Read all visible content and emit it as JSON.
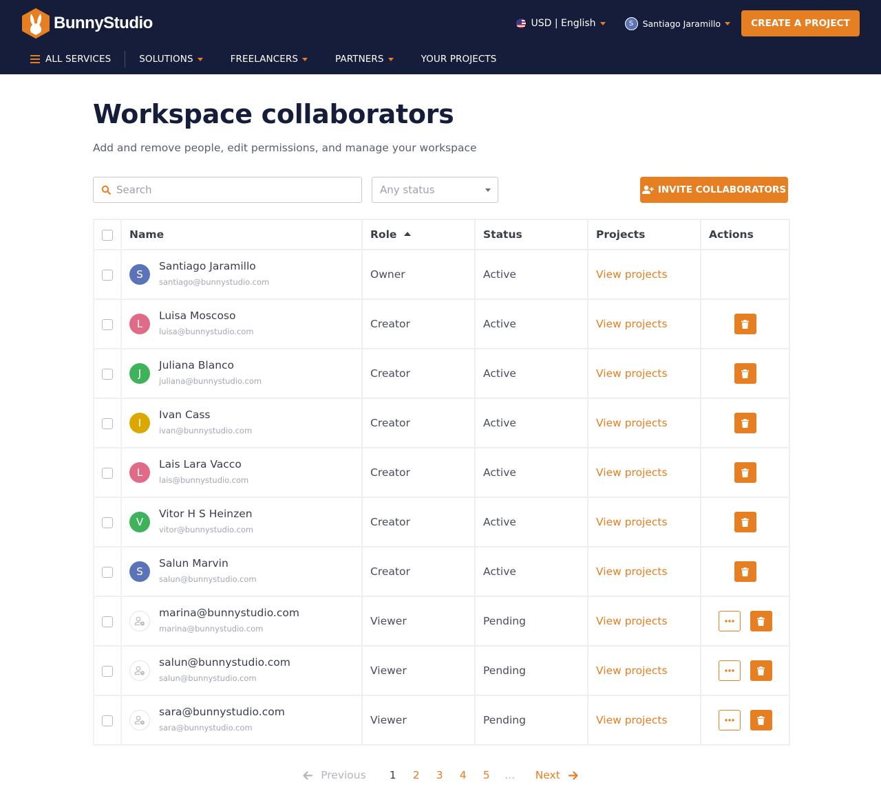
{
  "brand": {
    "name": "BunnyStudio",
    "accent": "#e67e22",
    "navy": "#161d3a"
  },
  "header": {
    "locale_label": "USD | English",
    "user_initial": "S",
    "user_name": "Santiago Jaramillo",
    "create_button": "CREATE A PROJECT"
  },
  "nav": {
    "all_services": "ALL SERVICES",
    "items": [
      {
        "label": "SOLUTIONS",
        "dropdown": true
      },
      {
        "label": "FREELANCERS",
        "dropdown": true
      },
      {
        "label": "PARTNERS",
        "dropdown": true
      },
      {
        "label": "YOUR PROJECTS",
        "dropdown": false
      }
    ]
  },
  "page": {
    "title": "Workspace collaborators",
    "subtitle": "Add and remove people, edit permissions, and manage your workspace"
  },
  "controls": {
    "search_placeholder": "Search",
    "search_value": "",
    "status_selected": "Any status",
    "invite_button": "INVITE COLLABORATORS"
  },
  "table": {
    "columns": {
      "name": "Name",
      "role": "Role",
      "status": "Status",
      "projects": "Projects",
      "actions": "Actions"
    },
    "sort": {
      "column": "Role",
      "direction": "ascending"
    },
    "rows": [
      {
        "initial": "S",
        "avatar_color": "#5b73b8",
        "name": "Santiago Jaramillo",
        "email": "santiago@bunnystudio.com",
        "role": "Owner",
        "status": "Active",
        "projects_link": "View projects",
        "actions": []
      },
      {
        "initial": "L",
        "avatar_color": "#e06b86",
        "name": "Luisa Moscoso",
        "email": "luisa@bunnystudio.com",
        "role": "Creator",
        "status": "Active",
        "projects_link": "View projects",
        "actions": [
          "delete"
        ]
      },
      {
        "initial": "J",
        "avatar_color": "#3fb35c",
        "name": "Juliana Blanco",
        "email": "juliana@bunnystudio.com",
        "role": "Creator",
        "status": "Active",
        "projects_link": "View projects",
        "actions": [
          "delete"
        ]
      },
      {
        "initial": "I",
        "avatar_color": "#dba800",
        "name": "Ivan Cass",
        "email": "ivan@bunnystudio.com",
        "role": "Creator",
        "status": "Active",
        "projects_link": "View projects",
        "actions": [
          "delete"
        ]
      },
      {
        "initial": "L",
        "avatar_color": "#e06b86",
        "name": "Lais Lara Vacco",
        "email": "lais@bunnystudio.com",
        "role": "Creator",
        "status": "Active",
        "projects_link": "View projects",
        "actions": [
          "delete"
        ]
      },
      {
        "initial": "V",
        "avatar_color": "#3fb35c",
        "name": "Vitor H S Heinzen",
        "email": "vitor@bunnystudio.com",
        "role": "Creator",
        "status": "Active",
        "projects_link": "View projects",
        "actions": [
          "delete"
        ]
      },
      {
        "initial": "S",
        "avatar_color": "#5b73b8",
        "name": "Salun Marvin",
        "email": "salun@bunnystudio.com",
        "role": "Creator",
        "status": "Active",
        "projects_link": "View projects",
        "actions": [
          "delete"
        ]
      },
      {
        "initial": "",
        "avatar_color": "pending-user-icon",
        "name": "marina@bunnystudio.com",
        "email": "marina@bunnystudio.com",
        "role": "Viewer",
        "status": "Pending",
        "projects_link": "View projects",
        "actions": [
          "more",
          "delete"
        ]
      },
      {
        "initial": "",
        "avatar_color": "pending-user-icon",
        "name": "salun@bunnystudio.com",
        "email": "salun@bunnystudio.com",
        "role": "Viewer",
        "status": "Pending",
        "projects_link": "View projects",
        "actions": [
          "more",
          "delete"
        ]
      },
      {
        "initial": "",
        "avatar_color": "pending-user-icon",
        "name": "sara@bunnystudio.com",
        "email": "sara@bunnystudio.com",
        "role": "Viewer",
        "status": "Pending",
        "projects_link": "View projects",
        "actions": [
          "more",
          "delete"
        ]
      }
    ]
  },
  "pagination": {
    "previous": "Previous",
    "next": "Next",
    "pages": [
      "1",
      "2",
      "3",
      "4",
      "5"
    ],
    "current": "1",
    "ellipsis": "..."
  }
}
